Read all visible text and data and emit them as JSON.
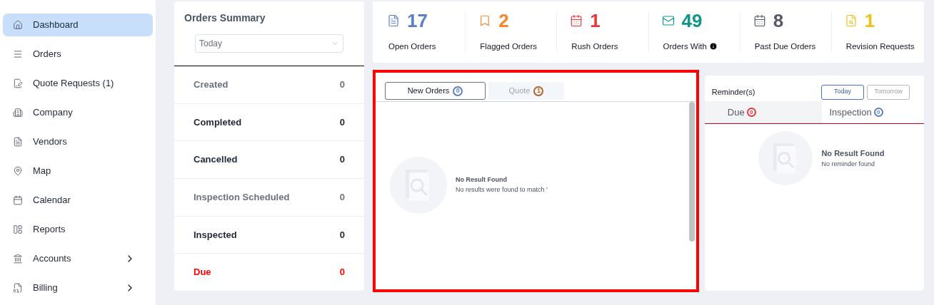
{
  "sidebar": {
    "items": [
      {
        "label": "Dashboard",
        "selected": true,
        "submenu": false
      },
      {
        "label": "Orders",
        "selected": false,
        "submenu": false
      },
      {
        "label": "Quote Requests (1)",
        "selected": false,
        "submenu": false
      },
      {
        "label": "Company",
        "selected": false,
        "submenu": false
      },
      {
        "label": "Vendors",
        "selected": false,
        "submenu": false
      },
      {
        "label": "Map",
        "selected": false,
        "submenu": false
      },
      {
        "label": "Calendar",
        "selected": false,
        "submenu": false
      },
      {
        "label": "Reports",
        "selected": false,
        "submenu": false
      },
      {
        "label": "Accounts",
        "selected": false,
        "submenu": true
      },
      {
        "label": "Billing",
        "selected": false,
        "submenu": true
      }
    ]
  },
  "orders_summary": {
    "title": "Orders Summary",
    "period": "Today",
    "rows": [
      {
        "label": "Created",
        "count": "0",
        "kind": "muted"
      },
      {
        "label": "Completed",
        "count": "0",
        "kind": "normal"
      },
      {
        "label": "Cancelled",
        "count": "0",
        "kind": "normal"
      },
      {
        "label": "Inspection Scheduled",
        "count": "0",
        "kind": "muted"
      },
      {
        "label": "Inspected",
        "count": "0",
        "kind": "normal"
      },
      {
        "label": "Due",
        "count": "0",
        "kind": "alert"
      }
    ]
  },
  "stats": [
    {
      "value": "17",
      "label": "Open Orders",
      "color": "#5a7fc8",
      "info": false
    },
    {
      "value": "2",
      "label": "Flagged Orders",
      "color": "#f5872e",
      "info": false
    },
    {
      "value": "1",
      "label": "Rush Orders",
      "color": "#e8383d",
      "info": false
    },
    {
      "value": "49",
      "label": "Orders With",
      "color": "#12968a",
      "info": true
    },
    {
      "value": "8",
      "label": "Past Due Orders",
      "color": "#555b66",
      "info": false
    },
    {
      "value": "1",
      "label": "Revision Requests",
      "color": "#f2c019",
      "info": false
    }
  ],
  "orders_panel": {
    "tabs": [
      {
        "label": "New Orders",
        "count": "0",
        "selected": true,
        "color": "#5a7fc8"
      },
      {
        "label": "Quote",
        "count": "1",
        "selected": false,
        "color": "#b5651d"
      }
    ],
    "empty": {
      "title": "No Result Found",
      "message": "No results were found to match '"
    }
  },
  "reminders": {
    "title": "Reminder(s)",
    "buttons": [
      {
        "label": "Today",
        "selected": true
      },
      {
        "label": "Tomorrow",
        "selected": false
      }
    ],
    "tabs": [
      {
        "label": "Due",
        "count": "0",
        "selected": true,
        "color": "#e8383d"
      },
      {
        "label": "Inspection",
        "count": "0",
        "selected": false,
        "color": "#5a7fc8"
      }
    ],
    "empty": {
      "title": "No Result Found",
      "message": "No reminder found"
    }
  }
}
